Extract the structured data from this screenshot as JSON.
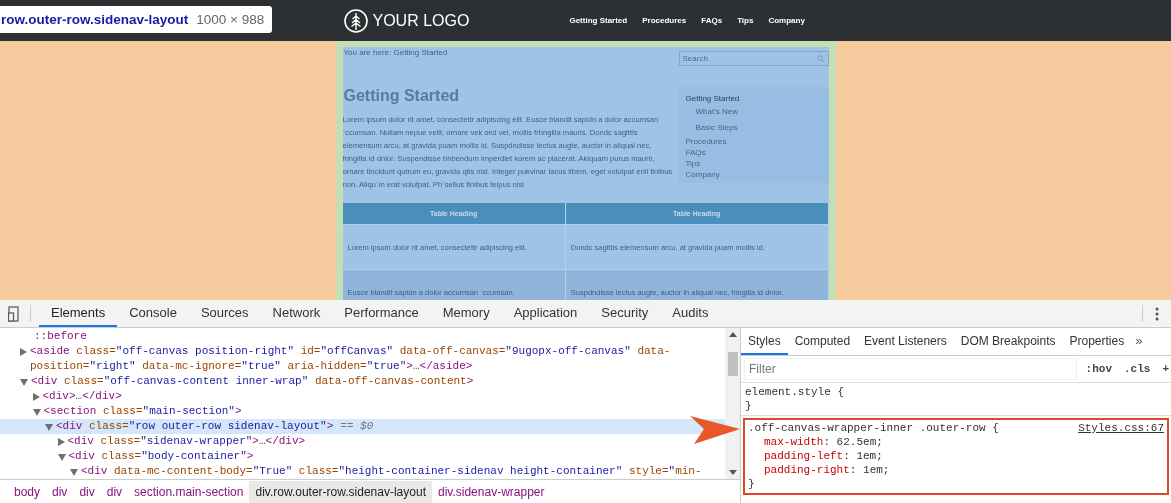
{
  "inspector_tooltip": {
    "selector": "row.outer-row.sidenav-layout",
    "size": "1000 × 988"
  },
  "site": {
    "logo": "YOUR LOGO",
    "nav": [
      "Getting Started",
      "Procedures",
      "FAQs",
      "Tips",
      "Company"
    ],
    "breadcrumb": "You are here: Getting Started",
    "search": {
      "placeholder": "Search"
    },
    "title": "Getting Started",
    "body": "Lorem ipsum dolor rit amet, consectettr adipiscing elit. Eusce blandit sapidn a dolor accumsan `ccumsan. Nullam nepue velit, ornare vek orci vel, mollis frhngilla mauris. Dondc sagittis elemensum arcu, at gravida puam mollis id. Suspdndisse lectus augte, auctor in aliqual nec, fringilla id dnlor. Suspendisse bhbendum imperdiet korem ac placerat. Akiquam purus maurir, ornare tincidunt qutrum eu, gravida qtis nisi. Integer pukvinar lacus libem, eget volutpat enil finibus non. Aliqu`m erat volutpat. Ph`sellus finibus telpus nisl",
    "sidenav": [
      {
        "label": "Getting Started",
        "selected": true,
        "children": [
          {
            "label": "What's New",
            "selected": false
          },
          {
            "label": "Basic Steps",
            "selected": false
          }
        ]
      },
      {
        "label": "Procedures",
        "selected": false
      },
      {
        "label": "FAQs",
        "selected": false
      },
      {
        "label": "Tips",
        "selected": false
      },
      {
        "label": "Company",
        "selected": false
      }
    ],
    "table": {
      "columns": [
        "Table Heading",
        "Table Heading"
      ],
      "rows": [
        [
          "Lorem ipsum dolor rit amet, consectettr adipiscing elit.",
          "Dondc sagittis elemensum arcu, at gravida puam mollis id."
        ],
        [
          "Eusce blandit sapidn a dolor accumsan `ccumsan.",
          "Suspdndisse lectus augte, auctor in aliqual nec, fringilla id dnlor."
        ]
      ]
    }
  },
  "devtools": {
    "tabs": [
      {
        "label": "Elements",
        "selected": true
      },
      {
        "label": "Console",
        "selected": false
      },
      {
        "label": "Sources",
        "selected": false
      },
      {
        "label": "Network",
        "selected": false
      },
      {
        "label": "Performance",
        "selected": false
      },
      {
        "label": "Memory",
        "selected": false
      },
      {
        "label": "Application",
        "selected": false
      },
      {
        "label": "Security",
        "selected": false
      },
      {
        "label": "Audits",
        "selected": false
      }
    ],
    "dom_tree": [
      {
        "kind": "pseudo",
        "markup": "::before",
        "selected": false
      },
      {
        "kind": "element",
        "markup": "<aside class=\"off-canvas position-right\" id=\"offCanvas\" data-off-canvas=\"9ugopx-off-canvas\" data-position=\"right\" data-mc-ignore=\"true\" aria-hidden=\"true\">…</aside>",
        "expanded": false,
        "selected": false
      },
      {
        "kind": "element",
        "markup": "<div class=\"off-canvas-content inner-wrap\" data-off-canvas-content>",
        "expanded": true,
        "selected": false,
        "children": [
          {
            "kind": "element",
            "markup": "<div>…</div>",
            "expanded": false,
            "selected": false
          },
          {
            "kind": "element",
            "markup": "<section class=\"main-section\">",
            "expanded": true,
            "selected": false,
            "children": [
              {
                "kind": "element",
                "markup": "<div class=\"row outer-row sidenav-layout\">",
                "console_ref": "== $0",
                "expanded": true,
                "selected": true,
                "children": [
                  {
                    "kind": "element",
                    "markup": "<div class=\"sidenav-wrapper\">…</div>",
                    "expanded": false,
                    "selected": false
                  },
                  {
                    "kind": "element",
                    "markup": "<div class=\"body-container\">",
                    "expanded": true,
                    "selected": false,
                    "children": [
                      {
                        "kind": "element",
                        "markup": "<div data-mc-content-body=\"True\" class=\"height-container-sidenav height-container\" style=\"min-",
                        "expanded": true,
                        "selected": false
                      }
                    ]
                  }
                ]
              }
            ]
          }
        ]
      }
    ],
    "breadcrumbs": [
      {
        "label": "body",
        "selected": false
      },
      {
        "label": "div",
        "selected": false
      },
      {
        "label": "div",
        "selected": false
      },
      {
        "label": "div",
        "selected": false
      },
      {
        "label": "section.main-section",
        "selected": false
      },
      {
        "label": "div.row.outer-row.sidenav-layout",
        "selected": true
      },
      {
        "label": "div.sidenav-wrapper",
        "selected": false
      }
    ],
    "styles_tabs": [
      {
        "label": "Styles",
        "selected": true
      },
      {
        "label": "Computed",
        "selected": false
      },
      {
        "label": "Event Listeners",
        "selected": false
      },
      {
        "label": "DOM Breakpoints",
        "selected": false
      },
      {
        "label": "Properties",
        "selected": false
      }
    ],
    "more_tabs": "»",
    "filter": {
      "placeholder": "Filter"
    },
    "hov": ":hov",
    "cls": ".cls",
    "add": "+",
    "rules": [
      {
        "selector": "element.style {",
        "close": "}",
        "highlighted": false
      },
      {
        "selector": ".off-canvas-wrapper-inner .outer-row {",
        "source": "Styles.css:67",
        "close": "}",
        "highlighted": true,
        "declarations": [
          "max-width: 62.5em;",
          "padding-left: 1em;",
          "padding-right: 1em;"
        ]
      }
    ]
  }
}
